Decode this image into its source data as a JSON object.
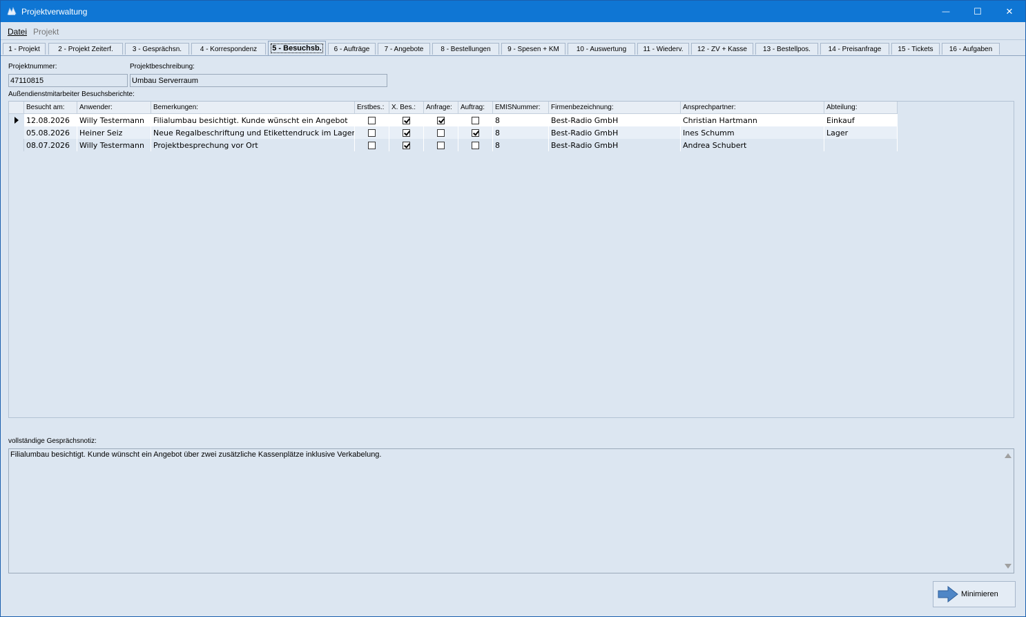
{
  "window": {
    "title": "Projektverwaltung",
    "minimize_glyph": "—",
    "maximize_glyph": "☐",
    "close_glyph": "✕"
  },
  "menu": {
    "items": [
      "Datei",
      "Projekt"
    ]
  },
  "tabs": [
    "1 - Projekt",
    "2 - Projekt Zeiterf.",
    "3 - Gesprächsn.",
    "4 - Korrespondenz",
    "5 - Besuchsb.",
    "6 - Aufträge",
    "7 - Angebote",
    "8 - Bestellungen",
    "9 - Spesen + KM",
    "10 - Auswertung",
    "11 - Wiederv.",
    "12 - ZV + Kasse",
    "13 - Bestellpos.",
    "14 - Preisanfrage",
    "15 - Tickets",
    "16 - Aufgaben"
  ],
  "active_tab": "5 - Besuchsb.",
  "form": {
    "projektnummer_label": "Projektnummer:",
    "projektnummer_value": "47110815",
    "projektbeschreibung_label": "Projektbeschreibung:",
    "projektbeschreibung_value": "Umbau Serverraum",
    "grid_label": "Außendienstmitarbeiter Besuchsberichte:"
  },
  "grid": {
    "columns": [
      "Besucht am:",
      "Anwender:",
      "Bemerkungen:",
      "Erstbes.:",
      "X. Bes.:",
      "Anfrage:",
      "Auftrag:",
      "EMISNummer:",
      "Firmenbezeichnung:",
      "Ansprechpartner:",
      "Abteilung:"
    ],
    "rows": [
      {
        "date": "12.08.2026",
        "user": "Willy Testermann",
        "remark": "Filialumbau besichtigt. Kunde wünscht ein Angebot",
        "erstbes": false,
        "xbes": true,
        "anfrage": true,
        "auftrag": false,
        "emis": "8",
        "firma": "Best-Radio GmbH",
        "ansprech": "Christian Hartmann",
        "abteilung": "Einkauf"
      },
      {
        "date": "05.08.2026",
        "user": "Heiner Seiz",
        "remark": "Neue Regalbeschriftung und Etikettendruck im Lager",
        "erstbes": false,
        "xbes": true,
        "anfrage": false,
        "auftrag": true,
        "emis": "8",
        "firma": "Best-Radio GmbH",
        "ansprech": "Ines Schumm",
        "abteilung": "Lager"
      },
      {
        "date": "08.07.2026",
        "user": "Willy Testermann",
        "remark": "Projektbesprechung vor Ort",
        "erstbes": false,
        "xbes": true,
        "anfrage": false,
        "auftrag": false,
        "emis": "8",
        "firma": "Best-Radio GmbH",
        "ansprech": "Andrea Schubert",
        "abteilung": ""
      }
    ]
  },
  "notes": {
    "label": "vollständige Gesprächsnotiz:",
    "text": "Filialumbau besichtigt. Kunde wünscht ein Angebot über zwei zusätzliche Kassenplätze inklusive Verkabelung."
  },
  "buttons": {
    "minimize_label": "Minimieren"
  },
  "colors": {
    "titlebar": "#0f76d4",
    "background": "#dce6f1",
    "selected_row": "#ffffff",
    "alt_row": "#e8eff7"
  }
}
